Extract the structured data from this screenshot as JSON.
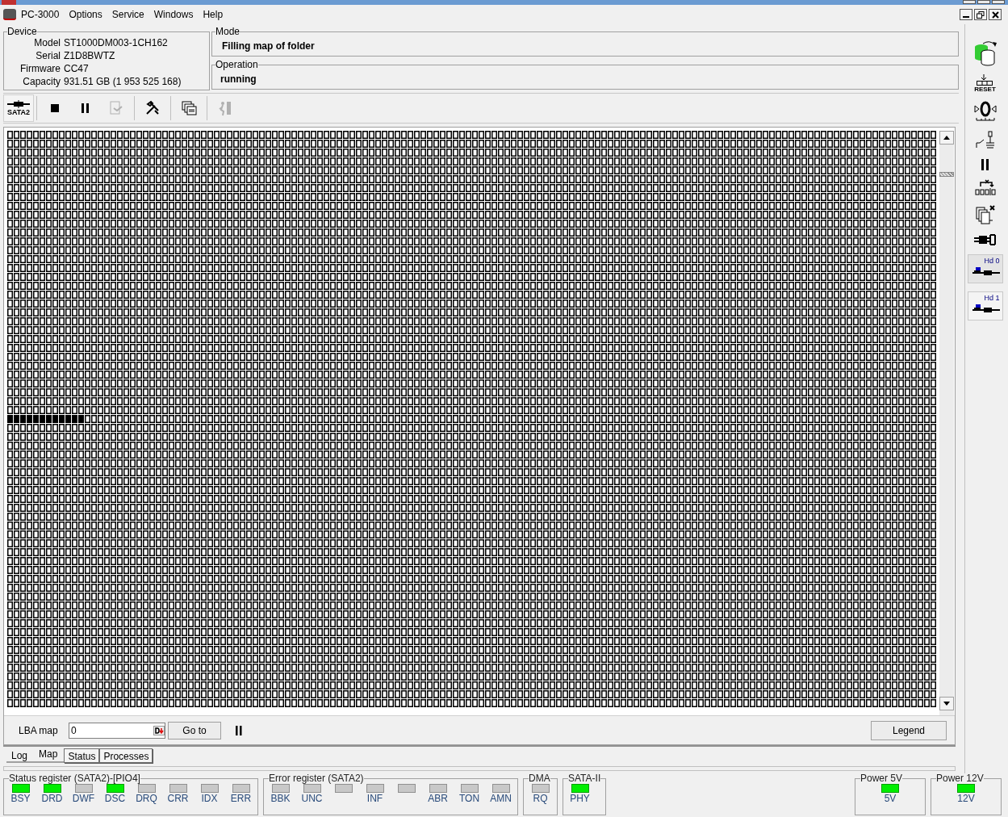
{
  "menu": [
    {
      "label": "PC-3000"
    },
    {
      "label": "Options"
    },
    {
      "label": "Service"
    },
    {
      "label": "Windows"
    },
    {
      "label": "Help"
    }
  ],
  "device": {
    "title": "Device",
    "fields": [
      {
        "label": "Model",
        "value": "ST1000DM003-1CH162"
      },
      {
        "label": "Serial",
        "value": "Z1D8BWTZ"
      },
      {
        "label": "Firmware",
        "value": "CC47"
      },
      {
        "label": "Capacity",
        "value": "931.51 GB (1 953 525 168)"
      }
    ]
  },
  "mode": {
    "title": "Mode",
    "value": "Filling map of folder"
  },
  "operation": {
    "title": "Operation",
    "value": "running"
  },
  "toolbar": [
    {
      "kind": "interface",
      "label": "SATA2",
      "disabled": false
    },
    {
      "kind": "stop",
      "disabled": false
    },
    {
      "kind": "pause",
      "disabled": false
    },
    {
      "kind": "export",
      "disabled": true
    },
    {
      "kind": "tools",
      "disabled": false
    },
    {
      "kind": "windows",
      "disabled": false
    },
    {
      "kind": "exit",
      "disabled": true
    }
  ],
  "lba_map": {
    "label": "LBA map",
    "value": "0",
    "goto": "Go to",
    "legend": "Legend"
  },
  "tabs": [
    {
      "label": "Log",
      "selected": false
    },
    {
      "label": "Map",
      "selected": true
    },
    {
      "label": "Status",
      "selected": false
    },
    {
      "label": "Processes",
      "selected": false
    }
  ],
  "side_toolbar": [
    {
      "kind": "drive-swap"
    },
    {
      "kind": "reset",
      "label": "RESET"
    },
    {
      "kind": "zero"
    },
    {
      "kind": "switch"
    },
    {
      "kind": "pause"
    },
    {
      "kind": "blocks"
    },
    {
      "kind": "pages"
    },
    {
      "kind": "connector"
    },
    {
      "kind": "head",
      "label": "Hd 0",
      "selected": true
    },
    {
      "kind": "head",
      "label": "Hd 1",
      "selected": false
    }
  ],
  "registers": [
    {
      "title": "Status register (SATA2)-[PIO4]",
      "leds": [
        {
          "label": "BSY",
          "on": true
        },
        {
          "label": "DRD",
          "on": true
        },
        {
          "label": "DWF",
          "on": false
        },
        {
          "label": "DSC",
          "on": true
        },
        {
          "label": "DRQ",
          "on": false
        },
        {
          "label": "CRR",
          "on": false
        },
        {
          "label": "IDX",
          "on": false
        },
        {
          "label": "ERR",
          "on": false
        }
      ]
    },
    {
      "title": "Error register (SATA2)",
      "leds": [
        {
          "label": "BBK",
          "on": false
        },
        {
          "label": "UNC",
          "on": false
        },
        {
          "on": false
        },
        {
          "label": "INF",
          "on": false
        },
        {
          "on": false
        },
        {
          "label": "ABR",
          "on": false
        },
        {
          "label": "TON",
          "on": false
        },
        {
          "label": "AMN",
          "on": false
        }
      ]
    },
    {
      "title": "DMA",
      "leds": [
        {
          "label": "RQ",
          "on": false
        }
      ]
    },
    {
      "title": "SATA-II",
      "leds": [
        {
          "label": "PHY",
          "on": true
        }
      ]
    }
  ],
  "power": [
    {
      "title": "Power 5V",
      "leds": [
        {
          "label": "5V",
          "on": true
        }
      ]
    },
    {
      "title": "Power 12V",
      "leds": [
        {
          "label": "12V",
          "on": true
        }
      ]
    }
  ]
}
